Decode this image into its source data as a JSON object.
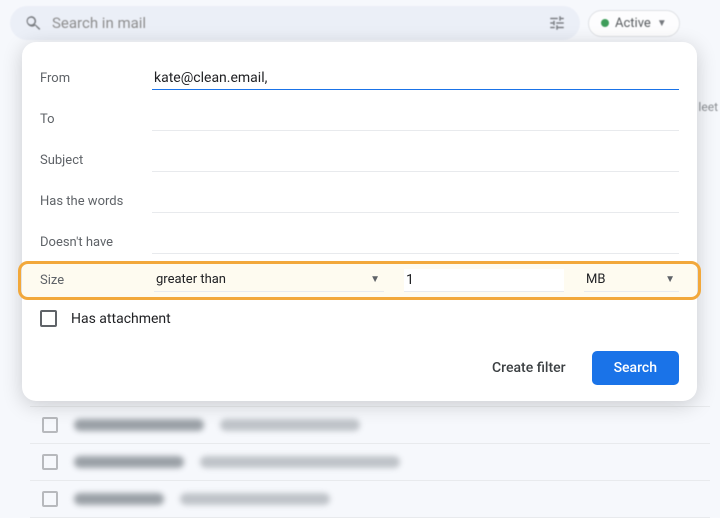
{
  "search": {
    "placeholder": "Search in mail"
  },
  "status_pill": {
    "label": "Active"
  },
  "side_text": "leet",
  "filter": {
    "from": {
      "label": "From",
      "value": "kate@clean.email,"
    },
    "to": {
      "label": "To",
      "value": ""
    },
    "subject": {
      "label": "Subject",
      "value": ""
    },
    "has_words": {
      "label": "Has the words",
      "value": ""
    },
    "doesnt_have": {
      "label": "Doesn't have",
      "value": ""
    },
    "size": {
      "label": "Size",
      "comparator": "greater than",
      "value": "1",
      "unit": "MB"
    },
    "has_attachment": {
      "label": "Has attachment",
      "checked": false
    }
  },
  "actions": {
    "create_filter": "Create filter",
    "search": "Search"
  }
}
